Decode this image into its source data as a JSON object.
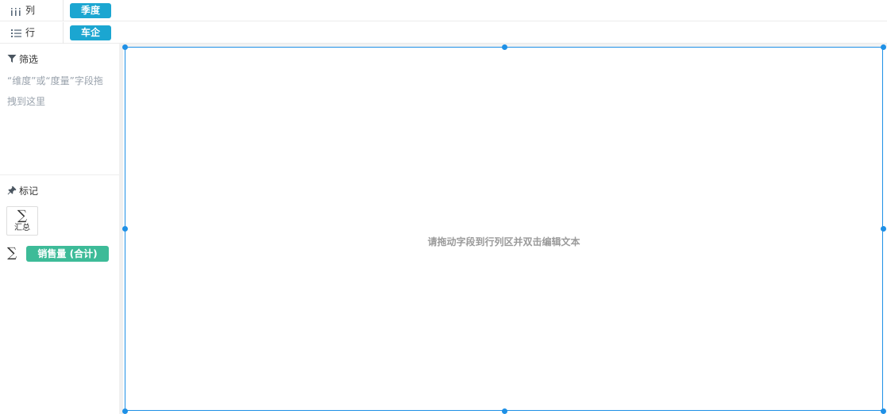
{
  "shelves": {
    "columns": {
      "icon": "columns-icon",
      "label": "列",
      "pill": "季度"
    },
    "rows": {
      "icon": "rows-list-icon",
      "label": "行",
      "pill": "车企"
    }
  },
  "filter": {
    "icon": "filter-icon",
    "title": "筛选",
    "hint": "“维度”或“度量”字段拖拽到这里"
  },
  "marks": {
    "icon": "pin-icon",
    "title": "标记",
    "aggregate": {
      "icon": "sigma-icon",
      "label": "汇总"
    },
    "measure": {
      "icon": "sigma-icon",
      "label": "销售量 (合计)"
    }
  },
  "canvas": {
    "hint": "请拖动字段到行列区并双击编辑文本"
  },
  "colors": {
    "dimension_pill": "#1ba6d1",
    "measure_pill": "#3dbb98",
    "selection": "#1e90e6"
  }
}
